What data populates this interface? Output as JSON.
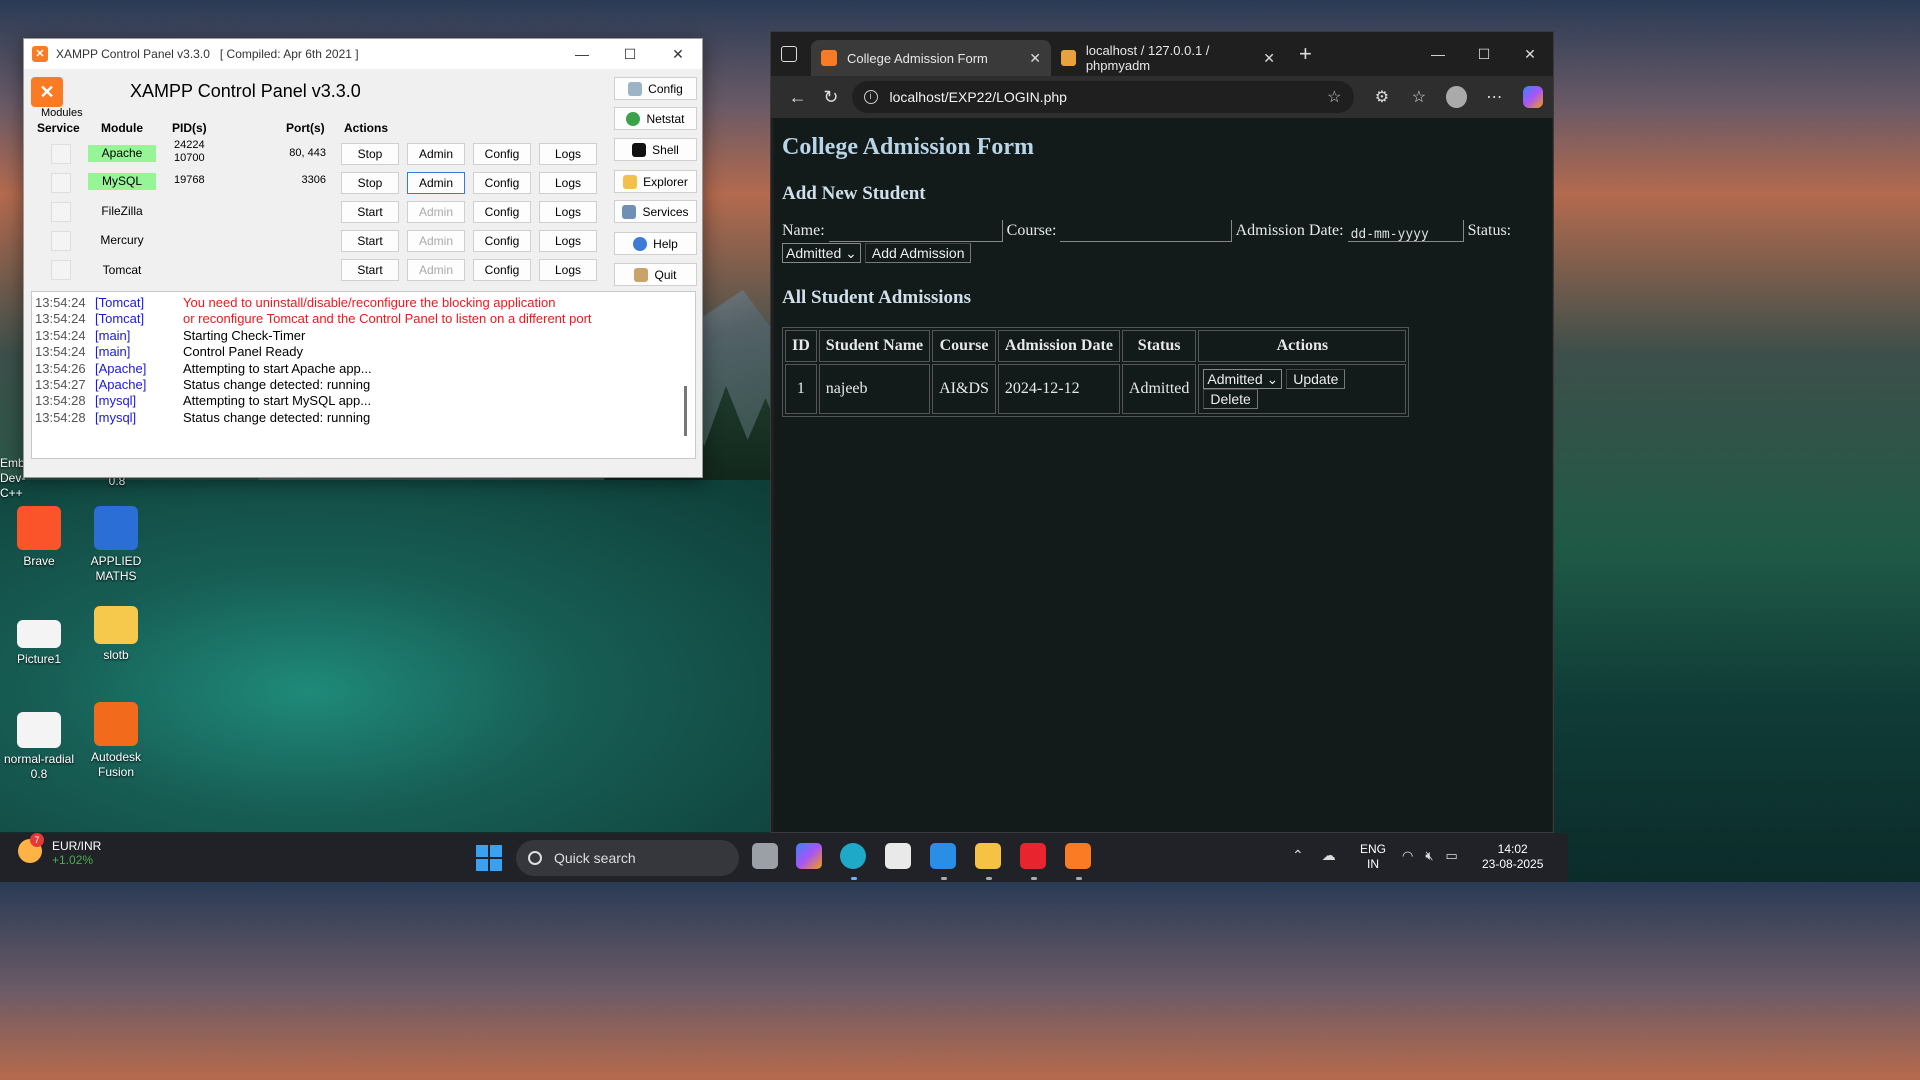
{
  "desktop": {
    "icons": [
      {
        "label": "Brave"
      },
      {
        "label": "APPLIED MATHS"
      },
      {
        "label": "Picture1"
      },
      {
        "label": "slotb"
      },
      {
        "label": "normal-radial 0.8"
      },
      {
        "label": "Autodesk Fusion"
      },
      {
        "label": "Emb Dev-C++"
      },
      {
        "label": "0.8"
      }
    ]
  },
  "xampp": {
    "title": "XAMPP Control Panel v3.3.0",
    "compiled": "[ Compiled: Apr 6th 2021 ]",
    "heading": "XAMPP Control Panel v3.3.0",
    "modules_label": "Modules",
    "columns": {
      "service": "Service",
      "module": "Module",
      "pids": "PID(s)",
      "ports": "Port(s)",
      "actions": "Actions"
    },
    "rows": [
      {
        "module": "Apache",
        "pid1": "24224",
        "pid2": "10700",
        "port": "80, 443",
        "action": "Stop",
        "admin": "Admin",
        "config": "Config",
        "logs": "Logs"
      },
      {
        "module": "MySQL",
        "pid1": "19768",
        "pid2": "",
        "port": "3306",
        "action": "Stop",
        "admin": "Admin",
        "config": "Config",
        "logs": "Logs"
      },
      {
        "module": "FileZilla",
        "pid1": "",
        "pid2": "",
        "port": "",
        "action": "Start",
        "admin": "Admin",
        "config": "Config",
        "logs": "Logs"
      },
      {
        "module": "Mercury",
        "pid1": "",
        "pid2": "",
        "port": "",
        "action": "Start",
        "admin": "Admin",
        "config": "Config",
        "logs": "Logs"
      },
      {
        "module": "Tomcat",
        "pid1": "",
        "pid2": "",
        "port": "",
        "action": "Start",
        "admin": "Admin",
        "config": "Config",
        "logs": "Logs"
      }
    ],
    "side_buttons": {
      "config": "Config",
      "netstat": "Netstat",
      "shell": "Shell",
      "explorer": "Explorer",
      "services": "Services",
      "help": "Help",
      "quit": "Quit"
    },
    "log": [
      {
        "time": "13:54:24",
        "src": "[Tomcat]",
        "msg": "You need to uninstall/disable/reconfigure the blocking application"
      },
      {
        "time": "13:54:24",
        "src": "[Tomcat]",
        "msg": "or reconfigure Tomcat and the Control Panel to listen on a different port"
      },
      {
        "time": "13:54:24",
        "src": "[main]",
        "msg": "Starting Check-Timer"
      },
      {
        "time": "13:54:24",
        "src": "[main]",
        "msg": "Control Panel Ready"
      },
      {
        "time": "13:54:26",
        "src": "[Apache]",
        "msg": "Attempting to start Apache app..."
      },
      {
        "time": "13:54:27",
        "src": "[Apache]",
        "msg": "Status change detected: running"
      },
      {
        "time": "13:54:28",
        "src": "[mysql]",
        "msg": "Attempting to start MySQL app..."
      },
      {
        "time": "13:54:28",
        "src": "[mysql]",
        "msg": "Status change detected: running"
      }
    ]
  },
  "browser": {
    "tabs": [
      {
        "title": "College Admission Form"
      },
      {
        "title": "localhost / 127.0.0.1 / phpmyadm"
      }
    ],
    "url": "localhost/EXP22/LOGIN.php",
    "page": {
      "title": "College Admission Form",
      "add_heading": "Add New Student",
      "labels": {
        "name": "Name:",
        "course": "Course:",
        "admission_date": "Admission Date:",
        "status": "Status:"
      },
      "date_placeholder": "dd-mm-yyyy",
      "status_value": "Admitted",
      "add_button": "Add Admission",
      "list_heading": "All Student Admissions",
      "table_headers": [
        "ID",
        "Student Name",
        "Course",
        "Admission Date",
        "Status",
        "Actions"
      ],
      "rows": [
        {
          "id": "1",
          "name": "najeeb",
          "course": "AI&DS",
          "date": "2024-12-12",
          "status": "Admitted",
          "select": "Admitted",
          "update": "Update",
          "delete": "Delete"
        }
      ]
    }
  },
  "taskbar": {
    "weather_badge": "7",
    "ticker_name": "EUR/INR",
    "ticker_change": "+1.02%",
    "search_placeholder": "Quick search",
    "lang1": "ENG",
    "lang2": "IN",
    "time": "14:02",
    "date": "23-08-2025"
  }
}
